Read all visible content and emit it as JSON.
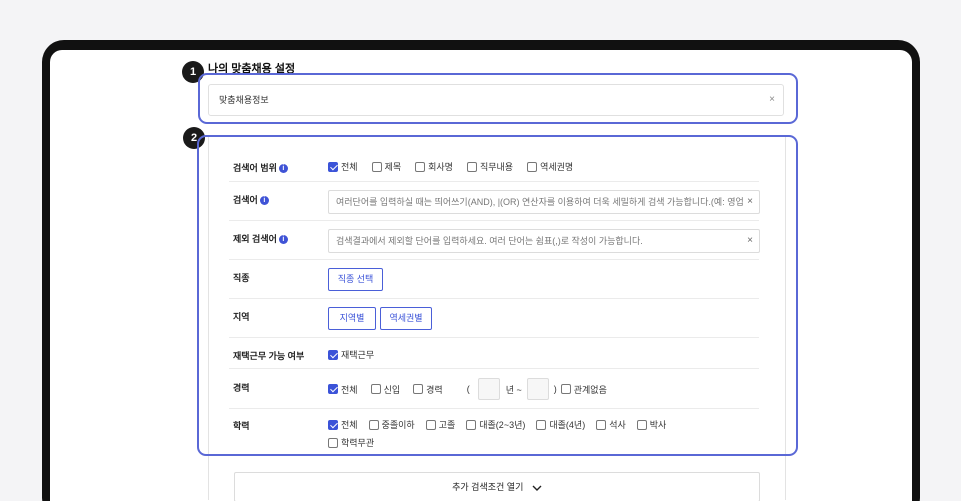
{
  "section": {
    "title": "나의 맞춤채용 설정",
    "step1": "1",
    "step2": "2"
  },
  "profile": {
    "value": "맞춤채용정보",
    "clear": "×"
  },
  "scope": {
    "label": "검색어 범위",
    "info": "i",
    "options": [
      "전체",
      "제목",
      "회사명",
      "직무내용",
      "역세권명"
    ],
    "checked": [
      true,
      false,
      false,
      false,
      false
    ]
  },
  "keyword": {
    "label": "검색어",
    "info": "i",
    "placeholder": "여러단어를 입력하실 때는 띄어쓰기(AND), |(OR) 연산자를 이용하여 더욱 세밀하게 검색 가능합니다.(예: 영업",
    "clear": "×"
  },
  "exclude": {
    "label": "제외 검색어",
    "info": "i",
    "placeholder": "검색결과에서 제외할 단어를 입력하세요. 여러 단어는 쉼표(,)로 작성이 가능합니다.",
    "clear": "×"
  },
  "job": {
    "label": "직종",
    "button": "직종 선택"
  },
  "region": {
    "label": "지역",
    "buttons": [
      "지역별",
      "역세권별"
    ]
  },
  "remote": {
    "label": "재택근무 가능 여부",
    "option": "재택근무",
    "checked": true
  },
  "career": {
    "label": "경력",
    "options": [
      "전체",
      "신입",
      "경력"
    ],
    "checked": [
      true,
      false,
      false
    ],
    "open_paren": "(",
    "year_sep": "년 ~",
    "close_paren": ")",
    "irrelevant": "관계없음"
  },
  "education": {
    "label": "학력",
    "options": [
      "전체",
      "중졸이하",
      "고졸",
      "대졸(2~3년)",
      "대졸(4년)",
      "석사",
      "박사",
      "학력무관"
    ],
    "checked": [
      true,
      false,
      false,
      false,
      false,
      false,
      false,
      false
    ]
  },
  "more": {
    "label": "추가 검색조건 열기",
    "icon": "chevron-down-icon"
  },
  "colors": {
    "accent": "#3b53d8",
    "highlight_border": "#5a68d6",
    "frame": "#111111"
  }
}
